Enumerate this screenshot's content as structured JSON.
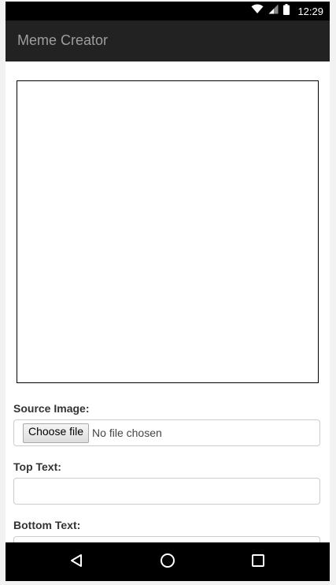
{
  "status_bar": {
    "time": "12:29",
    "icons": [
      "wifi-icon",
      "signal-icon",
      "battery-icon"
    ]
  },
  "app_bar": {
    "title": "Meme Creator"
  },
  "form": {
    "source_image": {
      "label": "Source Image:",
      "button_label": "Choose file",
      "status": "No file chosen"
    },
    "top_text": {
      "label": "Top Text:",
      "value": ""
    },
    "bottom_text": {
      "label": "Bottom Text:",
      "value": ""
    }
  },
  "nav_bar": {
    "icons": [
      "back-icon",
      "home-icon",
      "recents-icon"
    ]
  },
  "colors": {
    "status_bar": "#000000",
    "app_bar": "#222222",
    "title_text": "#9e9e9e",
    "nav_bar": "#000000"
  }
}
